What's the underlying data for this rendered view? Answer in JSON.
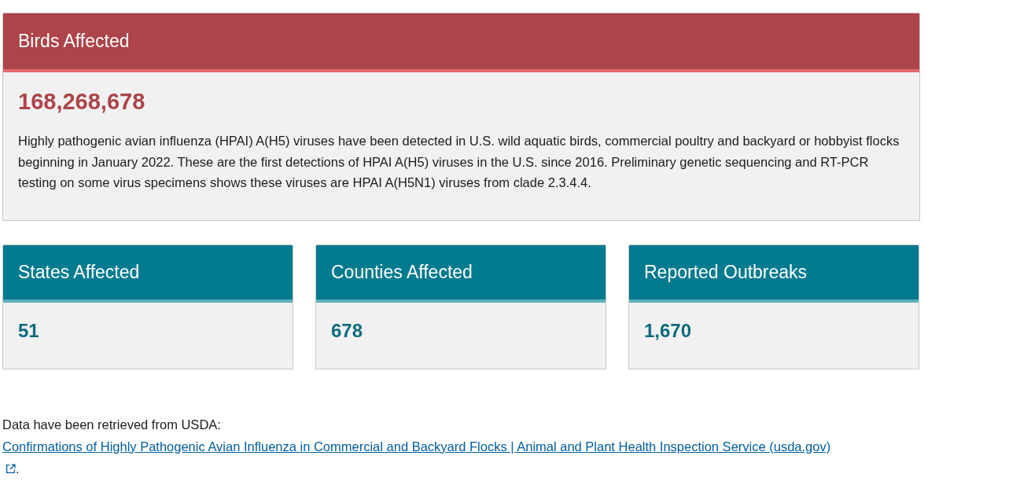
{
  "main_card": {
    "title": "Birds Affected",
    "value": "168,268,678",
    "description": "Highly pathogenic avian influenza (HPAI) A(H5) viruses have been detected in U.S. wild aquatic birds, commercial poultry and backyard or hobbyist flocks beginning in January 2022. These are the first detections of HPAI A(H5) viruses in the U.S. since 2016. Preliminary genetic sequencing and RT-PCR testing on some virus specimens shows these viruses are HPAI A(H5N1) viruses from clade 2.3.4.4."
  },
  "stat_cards": [
    {
      "title": "States Affected",
      "value": "51"
    },
    {
      "title": "Counties Affected",
      "value": "678"
    },
    {
      "title": "Reported Outbreaks",
      "value": "1,670"
    }
  ],
  "source_note": {
    "text": "Data have been retrieved from USDA:",
    "link": "Confirmations of Highly Pathogenic Avian Influenza in Commercial and Backyard Flocks | Animal and Plant Health Inspection Service (usda.gov)",
    "end": "."
  }
}
